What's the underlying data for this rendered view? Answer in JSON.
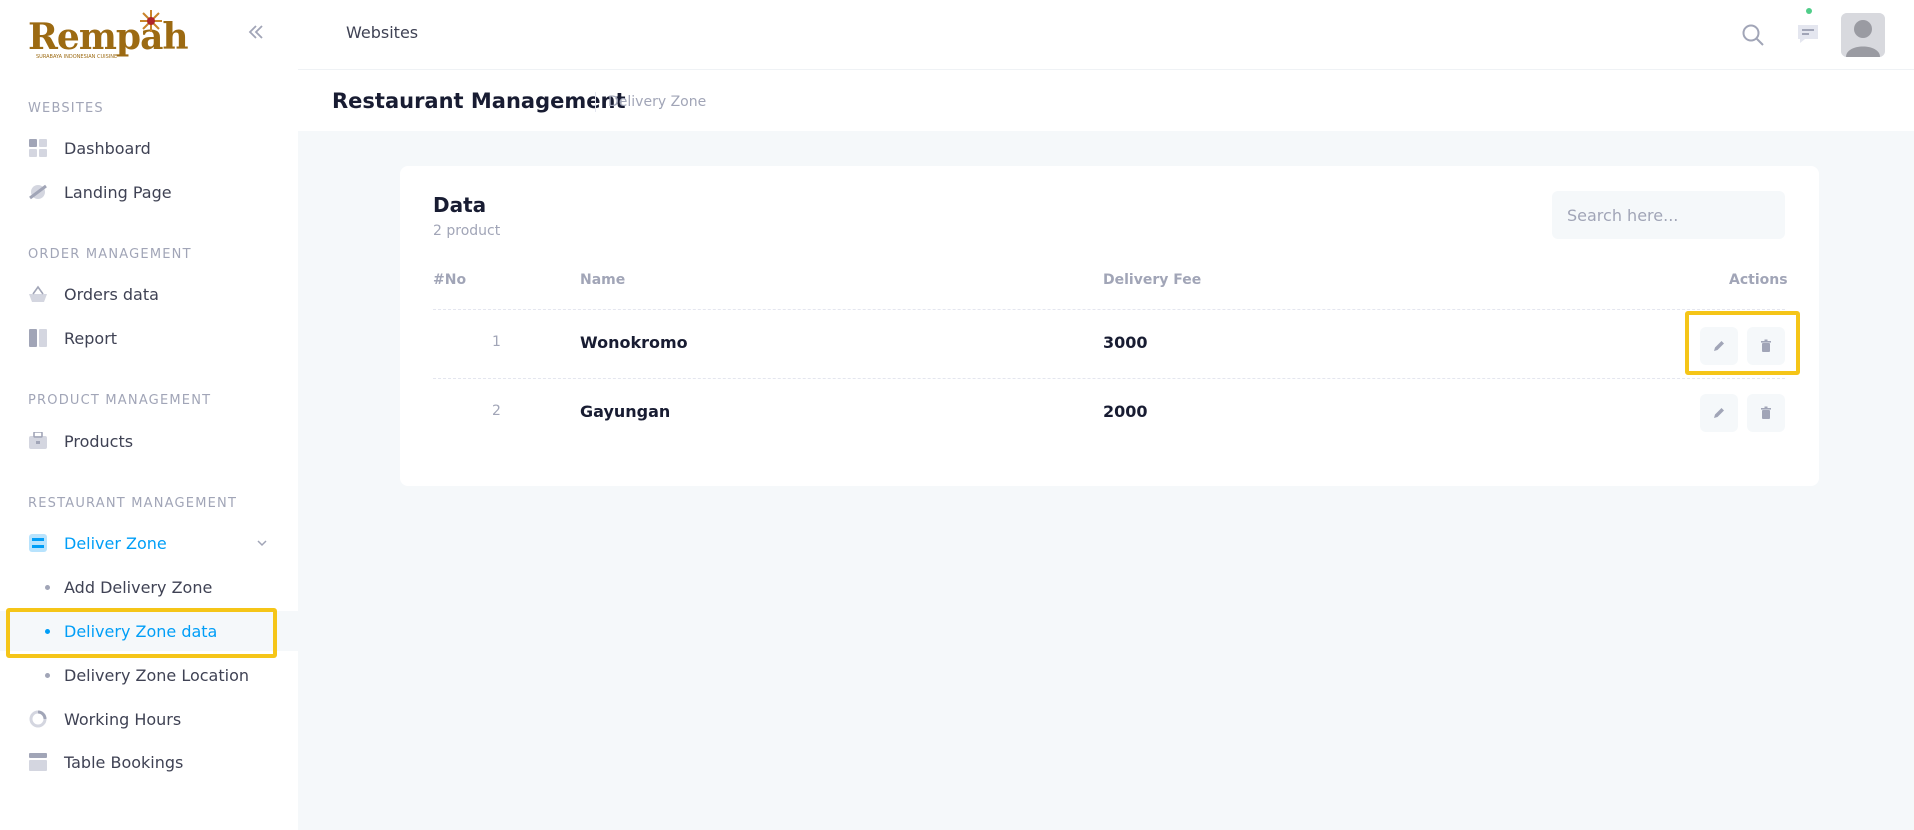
{
  "brand": {
    "logo_text": "Rempah",
    "logo_tagline": "SURABAYA INDONESIAN CUISINE"
  },
  "sidebar": {
    "sections": [
      {
        "title": "WEBSITES"
      },
      {
        "title": "ORDER MANAGEMENT"
      },
      {
        "title": "PRODUCT MANAGEMENT"
      },
      {
        "title": "RESTAURANT MANAGEMENT"
      }
    ],
    "items": {
      "dashboard": "Dashboard",
      "landing_page": "Landing Page",
      "orders_data": "Orders data",
      "report": "Report",
      "products": "Products",
      "deliver_zone": "Deliver Zone",
      "add_delivery_zone": "Add Delivery Zone",
      "delivery_zone_data": "Delivery Zone data",
      "delivery_zone_location": "Delivery Zone Location",
      "working_hours": "Working Hours",
      "table_bookings": "Table Bookings"
    }
  },
  "header": {
    "title": "Websites"
  },
  "toolbar": {
    "title": "Restaurant Management",
    "breadcrumb": "Delivery Zone"
  },
  "card": {
    "title": "Data",
    "subtitle": "2 product",
    "search_placeholder": "Search here...",
    "columns": {
      "no": "#No",
      "name": "Name",
      "fee": "Delivery Fee",
      "actions": "Actions"
    },
    "rows": [
      {
        "no": "1",
        "name": "Wonokromo",
        "fee": "3000"
      },
      {
        "no": "2",
        "name": "Gayungan",
        "fee": "2000"
      }
    ]
  },
  "colors": {
    "accent": "#009ef7",
    "highlight": "#f5c518",
    "logo": "#9c6a12"
  }
}
